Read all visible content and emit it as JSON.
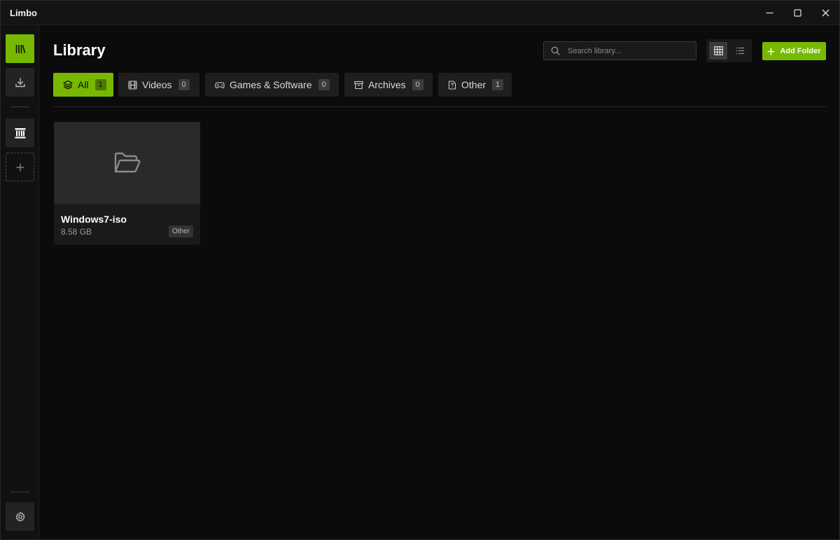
{
  "window": {
    "title": "Limbo"
  },
  "header": {
    "title": "Library",
    "search": {
      "placeholder": "Search library...",
      "value": ""
    },
    "add_folder_label": "Add Folder"
  },
  "tabs": [
    {
      "label": "All",
      "count": "1",
      "icon": "layers-icon",
      "active": true
    },
    {
      "label": "Videos",
      "count": "0",
      "icon": "film-icon",
      "active": false
    },
    {
      "label": "Games & Software",
      "count": "0",
      "icon": "gamepad-icon",
      "active": false
    },
    {
      "label": "Archives",
      "count": "0",
      "icon": "archive-icon",
      "active": false
    },
    {
      "label": "Other",
      "count": "1",
      "icon": "file-question-icon",
      "active": false
    }
  ],
  "items": [
    {
      "name": "Windows7-iso",
      "size": "8.58 GB",
      "type": "Other",
      "icon": "folder-open-icon"
    }
  ],
  "theme": {
    "accent": "#76b900",
    "background": "#0b0b0b"
  }
}
